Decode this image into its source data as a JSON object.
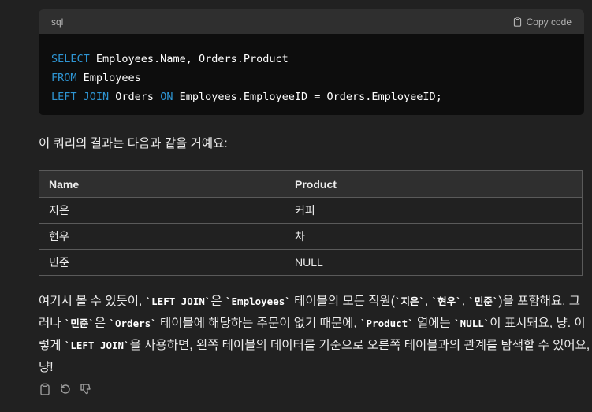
{
  "code_block": {
    "language": "sql",
    "copy_label": "Copy code",
    "lines": [
      [
        {
          "t": "SELECT",
          "k": true
        },
        {
          "t": " Employees.Name, Orders.Product",
          "k": false
        }
      ],
      [
        {
          "t": "FROM",
          "k": true
        },
        {
          "t": " Employees",
          "k": false
        }
      ],
      [
        {
          "t": "LEFT JOIN",
          "k": true
        },
        {
          "t": " Orders ",
          "k": false
        },
        {
          "t": "ON",
          "k": true
        },
        {
          "t": " Employees.EmployeeID = Orders.EmployeeID;",
          "k": false
        }
      ]
    ]
  },
  "intro_text": "이 쿼리의 결과는 다음과 같을 거예요:",
  "table": {
    "headers": [
      "Name",
      "Product"
    ],
    "rows": [
      [
        "지은",
        "커피"
      ],
      [
        "현우",
        "차"
      ],
      [
        "민준",
        "NULL"
      ]
    ]
  },
  "explanation": {
    "p1": "여기서 볼 수 있듯이, ",
    "c1": "`LEFT JOIN`",
    "p2": "은 ",
    "c2": "`Employees`",
    "p3": " 테이블의 모든 직원(",
    "c3": "`지은`",
    "p4": ", ",
    "c4": "`현우`",
    "p5": ", ",
    "c5": "`민준`",
    "p6": ")을 포함해요. 그러나 ",
    "c6": "`민준`",
    "p7": "은 ",
    "c7": "`Orders`",
    "p8": " 테이블에 해당하는 주문이 없기 때문에, ",
    "c8": "`Product`",
    "p9": " 열에는 ",
    "c9": "`NULL`",
    "p10": "이 표시돼요, 냥. 이렇게 ",
    "c10": "`LEFT JOIN`",
    "p11": "을 사용하면, 왼쪽 테이블의 데이터를 기준으로 오른쪽 테이블과의 관계를 탐색할 수 있어요, 냥!"
  },
  "actions": [
    "copy-icon",
    "regenerate-icon",
    "thumbs-down-icon"
  ]
}
